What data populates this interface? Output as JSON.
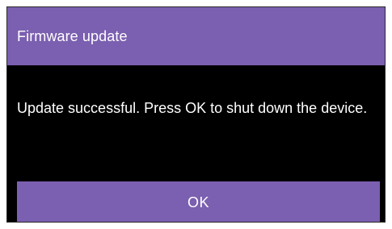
{
  "dialog": {
    "title": "Firmware update",
    "message": "Update successful. Press OK to shut down the device.",
    "ok_label": "OK"
  },
  "colors": {
    "accent": "#7b5fb0",
    "background": "#000000",
    "text": "#ffffff"
  }
}
